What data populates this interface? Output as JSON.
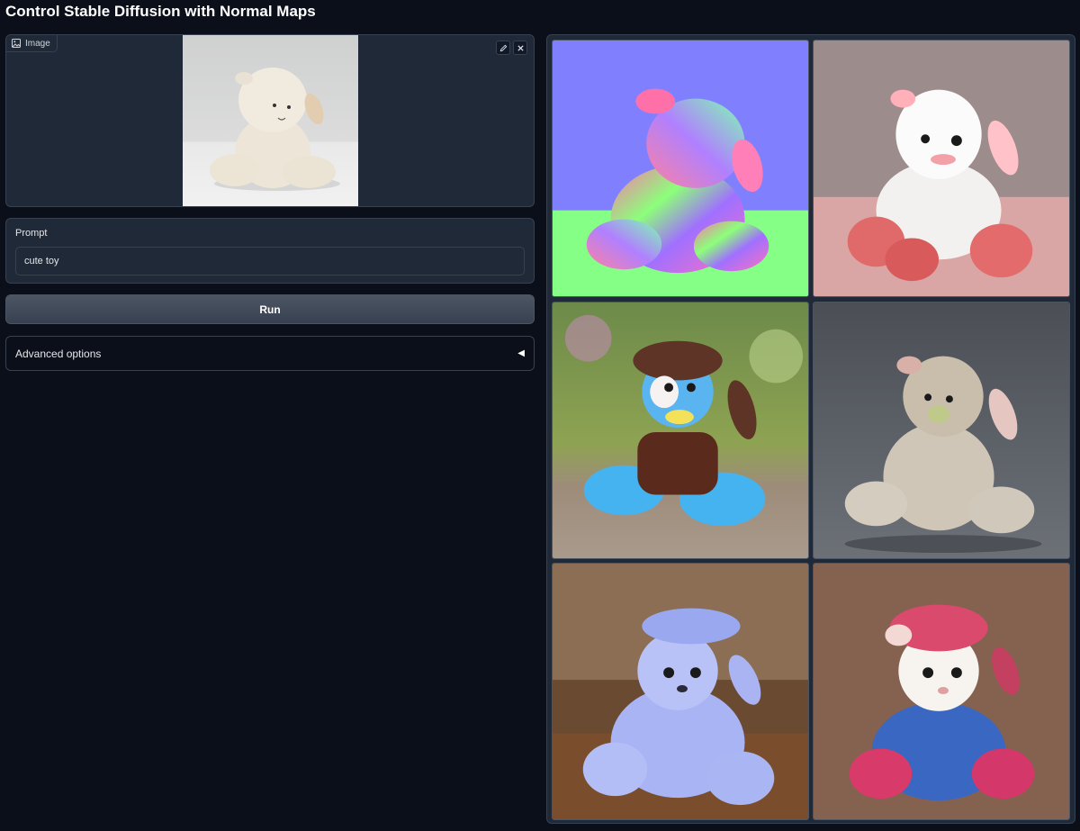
{
  "page": {
    "title": "Control Stable Diffusion with Normal Maps"
  },
  "image_input": {
    "label": "Image"
  },
  "prompt": {
    "label": "Prompt",
    "value": "cute toy"
  },
  "run": {
    "label": "Run"
  },
  "advanced": {
    "label": "Advanced options",
    "arrow": "◀"
  },
  "colors": {
    "background": "#0b0f19",
    "panel": "#1f2937",
    "border": "#374151",
    "normal_map_bg": "#8080ff"
  }
}
